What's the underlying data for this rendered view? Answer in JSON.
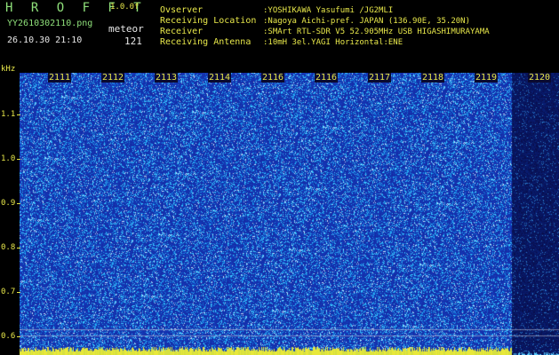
{
  "header": {
    "title": "H R O F F T",
    "version": "1.0.0f",
    "file_name": "YY2610302110.png",
    "mode": "meteor",
    "datetime": "26.10.30 21:10",
    "count": "121"
  },
  "station_info": [
    {
      "label": "Ovserver",
      "value": ":YOSHIKAWA Yasufumi /JG2MLI"
    },
    {
      "label": "Receiving Location",
      "value": ":Nagoya Aichi-pref. JAPAN (136.90E, 35.20N)"
    },
    {
      "label": "Receiver",
      "value": ":SMArt RTL-SDR V5 52.905MHz USB HIGASHIMURAYAMA"
    },
    {
      "label": "Receiving Antenna",
      "value": ":10mH 3el.YAGI Horizontal:ENE"
    }
  ],
  "y_axis": {
    "unit": "kHz",
    "ticks": [
      "1.1",
      "1.0",
      "0.9",
      "0.8",
      "0.7",
      "0.6"
    ]
  },
  "x_axis": {
    "ticks": [
      "2111",
      "2112",
      "2113",
      "2114",
      "2116",
      "2116",
      "2117",
      "2118",
      "2119",
      "2120"
    ]
  },
  "colors": {
    "background": "#000000",
    "spectrum_base": "#1a2fa8",
    "noise_cyan": "#3ec8ff",
    "baseline": "#e8e83a",
    "label": "#e8e84a"
  }
}
